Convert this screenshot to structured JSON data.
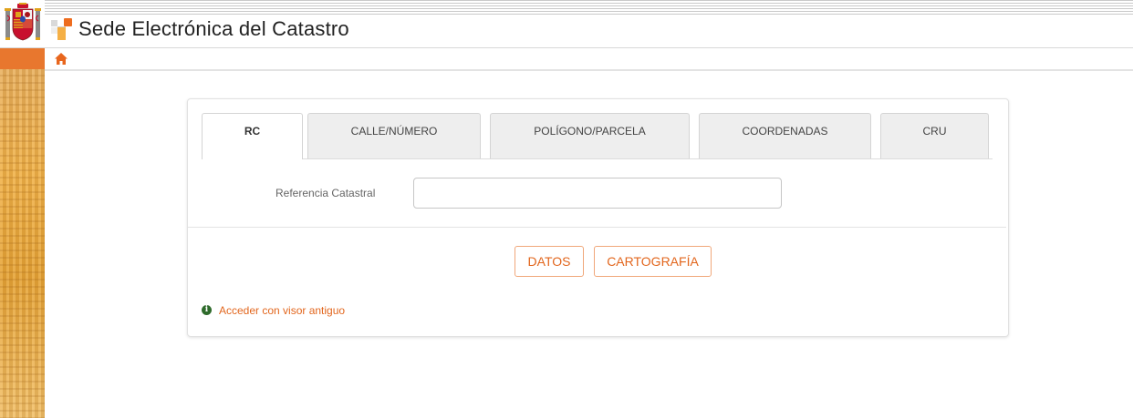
{
  "header": {
    "site_title": "Sede Electrónica del Catastro",
    "brand_color": "#e8772e"
  },
  "nav": {
    "home_icon": "home-icon"
  },
  "search": {
    "tabs": [
      {
        "label": "RC",
        "active": true
      },
      {
        "label": "CALLE/NÚMERO",
        "active": false
      },
      {
        "label": "POLÍGONO/PARCELA",
        "active": false
      },
      {
        "label": "COORDENADAS",
        "active": false
      },
      {
        "label": "CRU",
        "active": false
      }
    ],
    "field_label": "Referencia Catastral",
    "field_value": "",
    "field_placeholder": ""
  },
  "actions": {
    "datos_label": "DATOS",
    "cartografia_label": "CARTOGRAFÍA"
  },
  "footer_link": {
    "icon": "info-icon",
    "label": "Acceder con visor antiguo"
  }
}
